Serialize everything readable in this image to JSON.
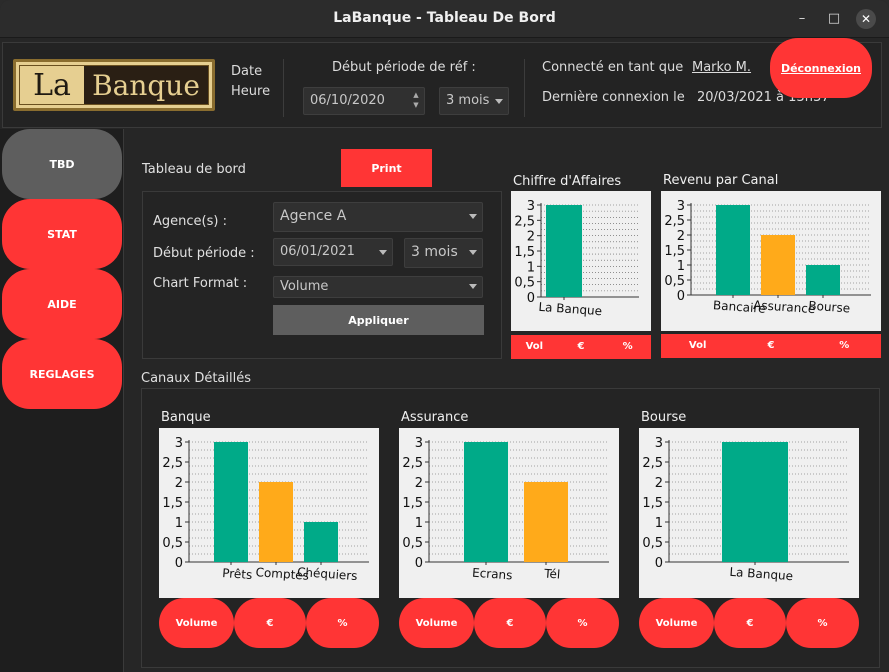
{
  "window": {
    "title": "LaBanque - Tableau De Bord"
  },
  "logo": {
    "part1": "La",
    "part2": "Banque"
  },
  "header": {
    "date_label": "Date",
    "time_label": "Heure",
    "ref_period_label": "Début période de réf :",
    "ref_date": "06/10/2020",
    "ref_duration": "3 mois",
    "connected_label": "Connecté en tant que",
    "user_name": "Marko M.",
    "last_login_label": "Dernière connexion le",
    "last_login_value": "20/03/2021 à 13h37",
    "logout_label": "Déconnexion"
  },
  "sidebar": {
    "items": [
      {
        "label": "TBD",
        "active": true
      },
      {
        "label": "STAT",
        "active": false
      },
      {
        "label": "AIDE",
        "active": false
      },
      {
        "label": "REGLAGES",
        "active": false
      }
    ]
  },
  "dashboard": {
    "title": "Tableau de bord",
    "print_label": "Print",
    "agency_label": "Agence(s) :",
    "agency_value": "Agence A",
    "period_label": "Début période :",
    "period_date": "06/01/2021",
    "period_duration": "3 mois",
    "format_label": "Chart Format :",
    "format_value": "Volume",
    "apply_label": "Appliquer",
    "channels_title": "Canaux Détaillés"
  },
  "colors": {
    "accent_red": "#ff3535",
    "teal": "#00aa88",
    "orange": "#ffaa1a"
  },
  "ca_buttons": [
    "Vol",
    "€",
    "%"
  ],
  "rev_buttons": [
    "Vol",
    "€",
    "%"
  ],
  "detail_buttons": [
    "Volume",
    "€",
    "%"
  ],
  "chart_data": [
    {
      "type": "bar",
      "title": "Chiffre d'Affaires",
      "categories": [
        "La Banque"
      ],
      "values": [
        3
      ],
      "ylim": [
        0,
        3
      ],
      "yticks": [
        "0",
        "0,5",
        "1",
        "1,5",
        "2",
        "2,5",
        "3"
      ],
      "colors": [
        "#00aa88"
      ]
    },
    {
      "type": "bar",
      "title": "Revenu par Canal",
      "categories": [
        "Bancaire",
        "Assurance",
        "Bourse"
      ],
      "values": [
        3,
        2,
        1
      ],
      "ylim": [
        0,
        3
      ],
      "yticks": [
        "0",
        "0,5",
        "1",
        "1,5",
        "2",
        "2,5",
        "3"
      ],
      "colors": [
        "#00aa88",
        "#ffaa1a",
        "#00aa88"
      ]
    },
    {
      "type": "bar",
      "title": "Banque",
      "categories": [
        "Prêts",
        "Comptes",
        "Chéquiers"
      ],
      "values": [
        3,
        2,
        1
      ],
      "ylim": [
        0,
        3
      ],
      "yticks": [
        "0",
        "0,5",
        "1",
        "1,5",
        "2",
        "2,5",
        "3"
      ],
      "colors": [
        "#00aa88",
        "#ffaa1a",
        "#00aa88"
      ]
    },
    {
      "type": "bar",
      "title": "Assurance",
      "categories": [
        "Ecrans",
        "Tél"
      ],
      "values": [
        3,
        2
      ],
      "ylim": [
        0,
        3
      ],
      "yticks": [
        "0",
        "0,5",
        "1",
        "1,5",
        "2",
        "2,5",
        "3"
      ],
      "colors": [
        "#00aa88",
        "#ffaa1a"
      ]
    },
    {
      "type": "bar",
      "title": "Bourse",
      "categories": [
        "La Banque"
      ],
      "values": [
        3
      ],
      "ylim": [
        0,
        3
      ],
      "yticks": [
        "0",
        "0,5",
        "1",
        "1,5",
        "2",
        "2,5",
        "3"
      ],
      "colors": [
        "#00aa88"
      ]
    }
  ]
}
